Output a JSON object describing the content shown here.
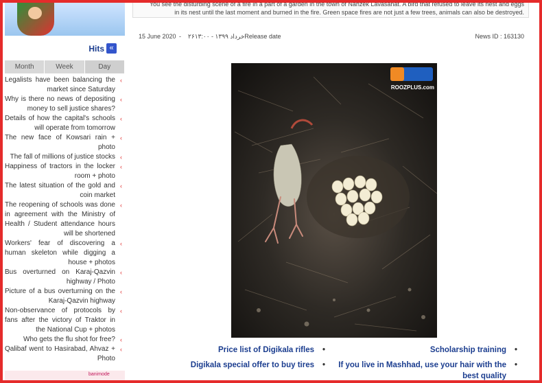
{
  "sidebar": {
    "hits_title": "Hits",
    "hits_button_glyph": "«",
    "tabs": [
      "Month",
      "Week",
      "Day"
    ],
    "items": [
      "Legalists have been balancing the market since Saturday",
      "Why is there no news of depositing money to sell justice shares?",
      "Details of how the capital's schools will operate from tomorrow",
      "The new face of Kowsari rain + photo",
      "The fall of millions of justice stocks",
      "Happiness of tractors in the locker room + photo",
      "The latest situation of the gold and coin market",
      "The reopening of schools was done in agreement with the Ministry of Health / Student attendance hours will be shortened",
      "Workers' fear of discovering a human skeleton while digging a house + photos",
      "Bus overturned on Karaj-Qazvin highway / Photo",
      "Picture of a bus overturning on the Karaj-Qazvin highway",
      "Non-observance of protocols by fans after the victory of Traktor in the National Cup + photos",
      "Who gets the flu shot for free?",
      "Qalibaf went to Hasirabad, Ahvaz + Photo"
    ],
    "bottom_banner_text": "banimode"
  },
  "article": {
    "summary_line1": "You see the disturbing scene of a fire in a part of a garden in the town of Nahzek Lavasanat. A bird that refused to leave its nest and eggs",
    "summary_line2": "in its nest until the last moment and burned in the fire. Green space fires are not just a few trees, animals can also be destroyed.",
    "date": "15 June 2020",
    "separator": "-",
    "release": "۲۶خرداد ۱۳۹۹ - ۱۳:۰۰Release date",
    "news_id": "News ID : 163130",
    "watermark": "ROOZPLUS.com"
  },
  "related": [
    "Scholarship training",
    "Price list of Digikala rifles",
    "If you live in Mashhad, use your hair with the best quality",
    "Digikala special offer to buy tires"
  ],
  "colors": {
    "frame": "#e52b2b",
    "link": "#1b3d8f",
    "bullet_chevron": "#e03131"
  }
}
